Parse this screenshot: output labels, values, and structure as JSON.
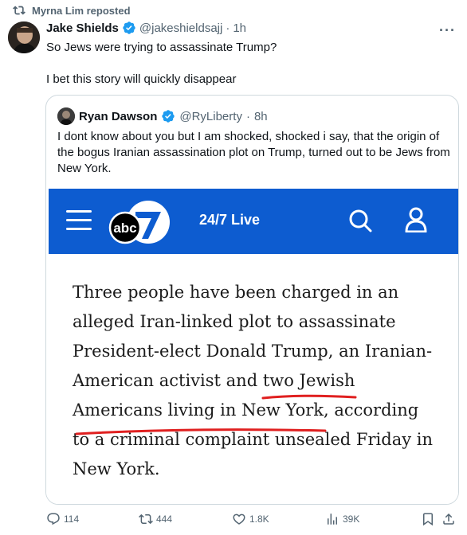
{
  "repost": {
    "text": "Myrna Lim reposted"
  },
  "tweet": {
    "author_name": "Jake Shields",
    "author_handle": "@jakeshieldsajj",
    "separator": "·",
    "time": "1h",
    "more": "···",
    "lines": [
      "So Jews were trying to assassinate Trump?",
      "I bet this story will quickly disappear"
    ]
  },
  "quote": {
    "author_name": "Ryan Dawson",
    "author_handle": "@RyLiberty",
    "separator": "·",
    "time": "8h",
    "text": "I dont know about you but I am shocked, shocked i say, that the origin of the bogus Iranian assassination plot on Trump, turned out to be Jews from New York.",
    "media": {
      "logo_text": "abc",
      "live_label": "24/7 Live",
      "article_lines": [
        "Three people have been charged in an",
        "alleged Iran-linked plot to assassinate",
        "President-elect Donald Trump, an Iranian-",
        "American activist and two Jewish",
        "Americans living in New York, according",
        "to a criminal complaint unsealed Friday in",
        "New York."
      ],
      "underline_color": "#e02020",
      "bar_color": "#0d5cd0"
    }
  },
  "actions": {
    "replies": "114",
    "reposts": "444",
    "likes": "1.8K",
    "views": "39K"
  },
  "colors": {
    "verified": "#1d9bf0",
    "muted": "#536471",
    "text": "#0f1419"
  }
}
